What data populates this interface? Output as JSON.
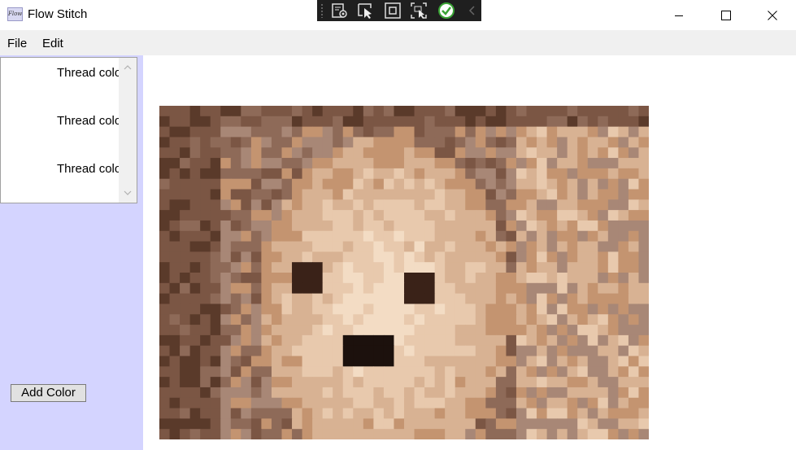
{
  "window": {
    "title": "Flow Stitch",
    "icon": "app-logo-icon",
    "icon_text": "Flow"
  },
  "debug_toolbar": {
    "tools": [
      "live-visual-tree-icon",
      "select-element-icon",
      "display-layout-adorners-icon",
      "track-focus-icon",
      "xaml-hot-reload-check-icon",
      "collapse-chevron-icon"
    ]
  },
  "menu": {
    "items": [
      "File",
      "Edit"
    ]
  },
  "thread_list": {
    "items": [
      "Thread color",
      "Thread color",
      "Thread color"
    ]
  },
  "add_color_button": {
    "label": "Add Color"
  },
  "colors": {
    "sidebar_background": "#d4d4ff",
    "menubar_background": "#f0f0f0",
    "debug_toolbar_background": "#1f1f1f"
  },
  "pattern": {
    "description": "pixelated stitch pattern of a dog face",
    "palette": [
      "#1c110d",
      "#3a2218",
      "#5a3a2a",
      "#7b5644",
      "#8e6a58",
      "#a88776",
      "#c49470",
      "#d8b293",
      "#e8c9ad",
      "#f3dcc4"
    ]
  }
}
